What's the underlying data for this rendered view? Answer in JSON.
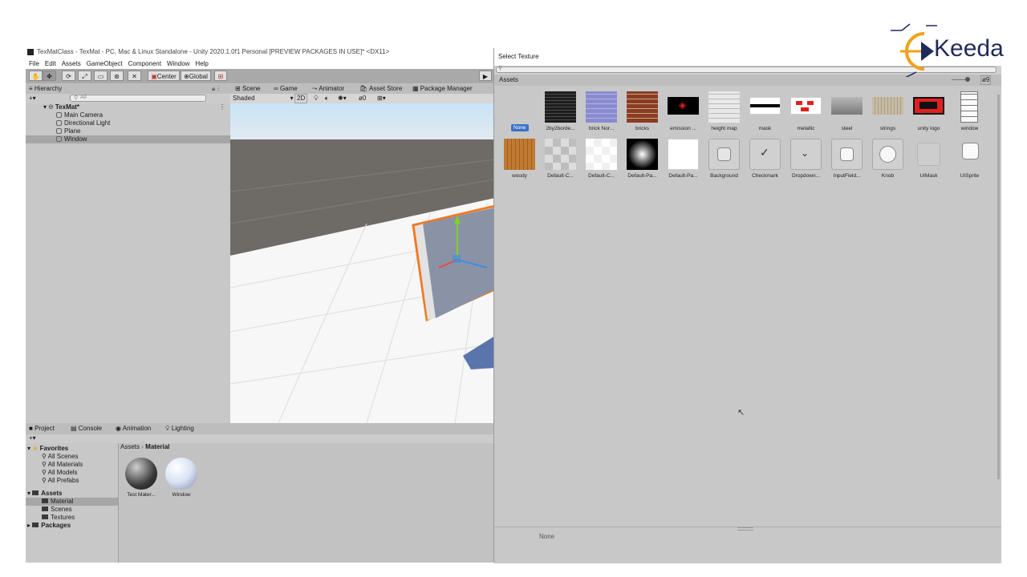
{
  "window_title": "TexMatClass - TexMat - PC, Mac & Linux Standalone - Unity 2020.1.0f1 Personal [PREVIEW PACKAGES IN USE]* <DX11>",
  "menu": [
    "File",
    "Edit",
    "Assets",
    "GameObject",
    "Component",
    "Window",
    "Help"
  ],
  "toolbar": {
    "pivot_label": "Center",
    "space_label": "Global"
  },
  "hierarchy": {
    "tab_label": "Hierarchy",
    "search_placeholder": "All",
    "scene_name": "TexMat*",
    "items": [
      "Main Camera",
      "Directional Light",
      "Plane",
      "Window"
    ],
    "selected": "Window"
  },
  "scene": {
    "tabs": [
      "Scene",
      "Game",
      "Animator",
      "Asset Store",
      "Package Manager"
    ],
    "shading_mode": "Shaded",
    "mode_2d": "2D",
    "hidden_count": "0"
  },
  "project": {
    "tabs": [
      "Project",
      "Console",
      "Animation",
      "Lighting"
    ],
    "favorites_label": "Favorites",
    "favorites": [
      "All Scenes",
      "All Materials",
      "All Models",
      "All Prefabs"
    ],
    "assets_label": "Assets",
    "asset_folders": [
      "Material",
      "Scenes",
      "Textures"
    ],
    "packages_label": "Packages",
    "breadcrumb_root": "Assets",
    "breadcrumb_current": "Material",
    "items": [
      "Test Mater...",
      "Window"
    ]
  },
  "picker": {
    "title": "Select Texture",
    "tab_label": "Assets",
    "count": "9",
    "none_label": "None",
    "textures_row1": [
      "2by2borde...",
      "brick Nor...",
      "bricks",
      "emission ...",
      "height map",
      "mask",
      "metallic",
      "steel",
      "strings",
      "unity logo",
      "window"
    ],
    "textures_row2": [
      "woody",
      "Default-C...",
      "Default-C...",
      "Default-Pa...",
      "Default-Pa...",
      "Background",
      "Checkmark",
      "Dropdown...",
      "InputField...",
      "Knob",
      "UIMask",
      "UISprite"
    ],
    "preview_label": "None"
  },
  "brand": {
    "name": "Keeda"
  },
  "colors": {
    "selection": "#3a72c8",
    "brand_orange": "#f0a21a",
    "brand_navy": "#1f2a5a",
    "gizmo_orange": "#f07a22"
  }
}
